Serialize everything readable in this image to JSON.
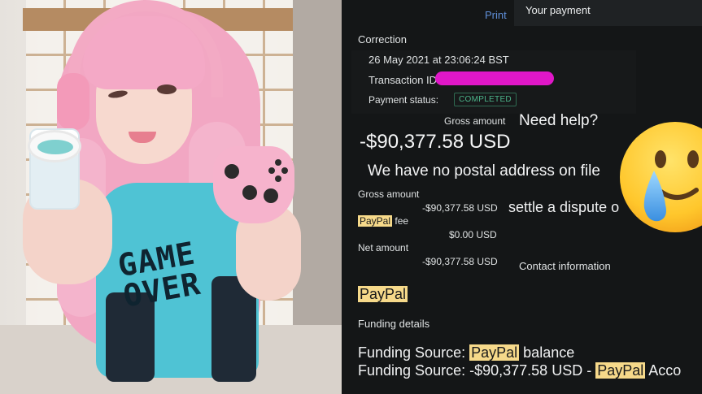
{
  "photo": {
    "shirt_text_line1": "GAME",
    "shirt_text_line2": "OVER"
  },
  "header": {
    "print_label": "Print",
    "title": "Your payment"
  },
  "transaction": {
    "section_label": "Correction",
    "date": "26 May 2021 at 23:06:24 BST",
    "transaction_id_label": "Transaction ID:",
    "payment_status_label": "Payment status:",
    "payment_status": "COMPLETED",
    "gross_amount_label": "Gross amount",
    "amount_large": "-$90,377.58 USD",
    "no_postal_address": "We have no postal address on file",
    "gross_amount_label_2": "Gross amount",
    "gross_amount_value": "-$90,377.58 USD",
    "paypal_word": "PayPal",
    "fee_label": "fee",
    "fee_value": "$0.00 USD",
    "net_amount_label": "Net amount",
    "net_amount_value": "-$90,377.58 USD"
  },
  "overlay": {
    "need_help": "Need help?",
    "settle_dispute": "settle a dispute o",
    "contact_information": "Contact information",
    "paypal_big": "PayPal",
    "funding_details": "Funding details",
    "funding_source_label": "Funding Source:",
    "funding_source_1_paypal": "PayPal",
    "funding_source_1_rest": "balance",
    "funding_source_2_amount": "-$90,377.58 USD -",
    "funding_source_2_paypal": "PayPal",
    "funding_source_2_rest": "Acco"
  },
  "colors": {
    "highlight": "#f6d98a",
    "redaction": "#e017c8",
    "status_green": "#4bb58a",
    "link_blue": "#5f8fd9"
  },
  "icons": {
    "emoji": "sad-smiling-face-with-tear-icon"
  }
}
